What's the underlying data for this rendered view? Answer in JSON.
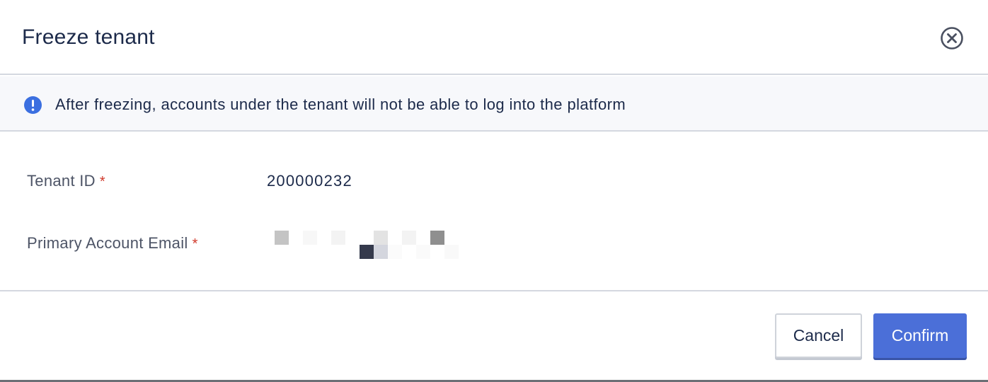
{
  "dialog": {
    "title": "Freeze tenant",
    "close_icon": "close-circle-icon"
  },
  "notice": {
    "icon": "info-exclamation-icon",
    "text": "After freezing, accounts under the tenant will not be able to log into the platform"
  },
  "form": {
    "tenant_id_label": "Tenant ID",
    "tenant_id_value": "200000232",
    "email_label": "Primary Account Email",
    "required_mark": "*"
  },
  "footer": {
    "cancel_label": "Cancel",
    "confirm_label": "Confirm"
  },
  "colors": {
    "accent": "#4b6fd8",
    "info_icon": "#3b6fe0",
    "required": "#d0392b",
    "text_primary": "#1c2a4a"
  }
}
